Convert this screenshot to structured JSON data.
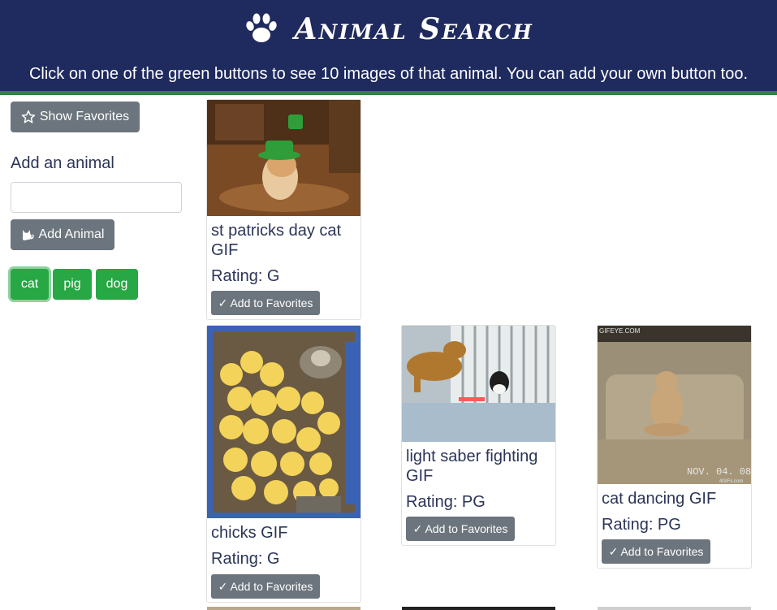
{
  "header": {
    "title": "Animal Search",
    "subtitle": "Click on one of the green buttons to see 10 images of that animal. You can add your own button too."
  },
  "sidebar": {
    "show_favorites_label": "Show Favorites",
    "add_label": "Add an animal",
    "add_input_value": "",
    "add_button_label": "Add Animal",
    "animals": [
      "cat",
      "pig",
      "dog"
    ],
    "active_animal": "cat"
  },
  "cards": [
    {
      "title": "st patricks day cat GIF",
      "rating": "Rating: G",
      "button": "✓ Add to Favorites"
    },
    {
      "title": "chicks GIF",
      "rating": "Rating: G",
      "button": "✓ Add to Favorites"
    },
    {
      "title": "light saber fighting GIF",
      "rating": "Rating: PG",
      "button": "✓ Add to Favorites"
    },
    {
      "title": "cat dancing GIF",
      "rating": "Rating: PG",
      "button": "✓ Add to Favorites"
    }
  ],
  "watermarks": {
    "gifeye": "GIFEYE.COM",
    "date": "NOV. 04. 08",
    "fourgifs": "4GIFs.com"
  },
  "icons": {
    "logo": "paw-icon",
    "favorites": "star-outline-icon",
    "add": "cat-icon"
  },
  "colors": {
    "header_bg": "#1f2a5e",
    "stripe": "#3a7d44",
    "animal_button": "#28a745",
    "gray_button": "#6c757d",
    "text": "#2c3557"
  }
}
